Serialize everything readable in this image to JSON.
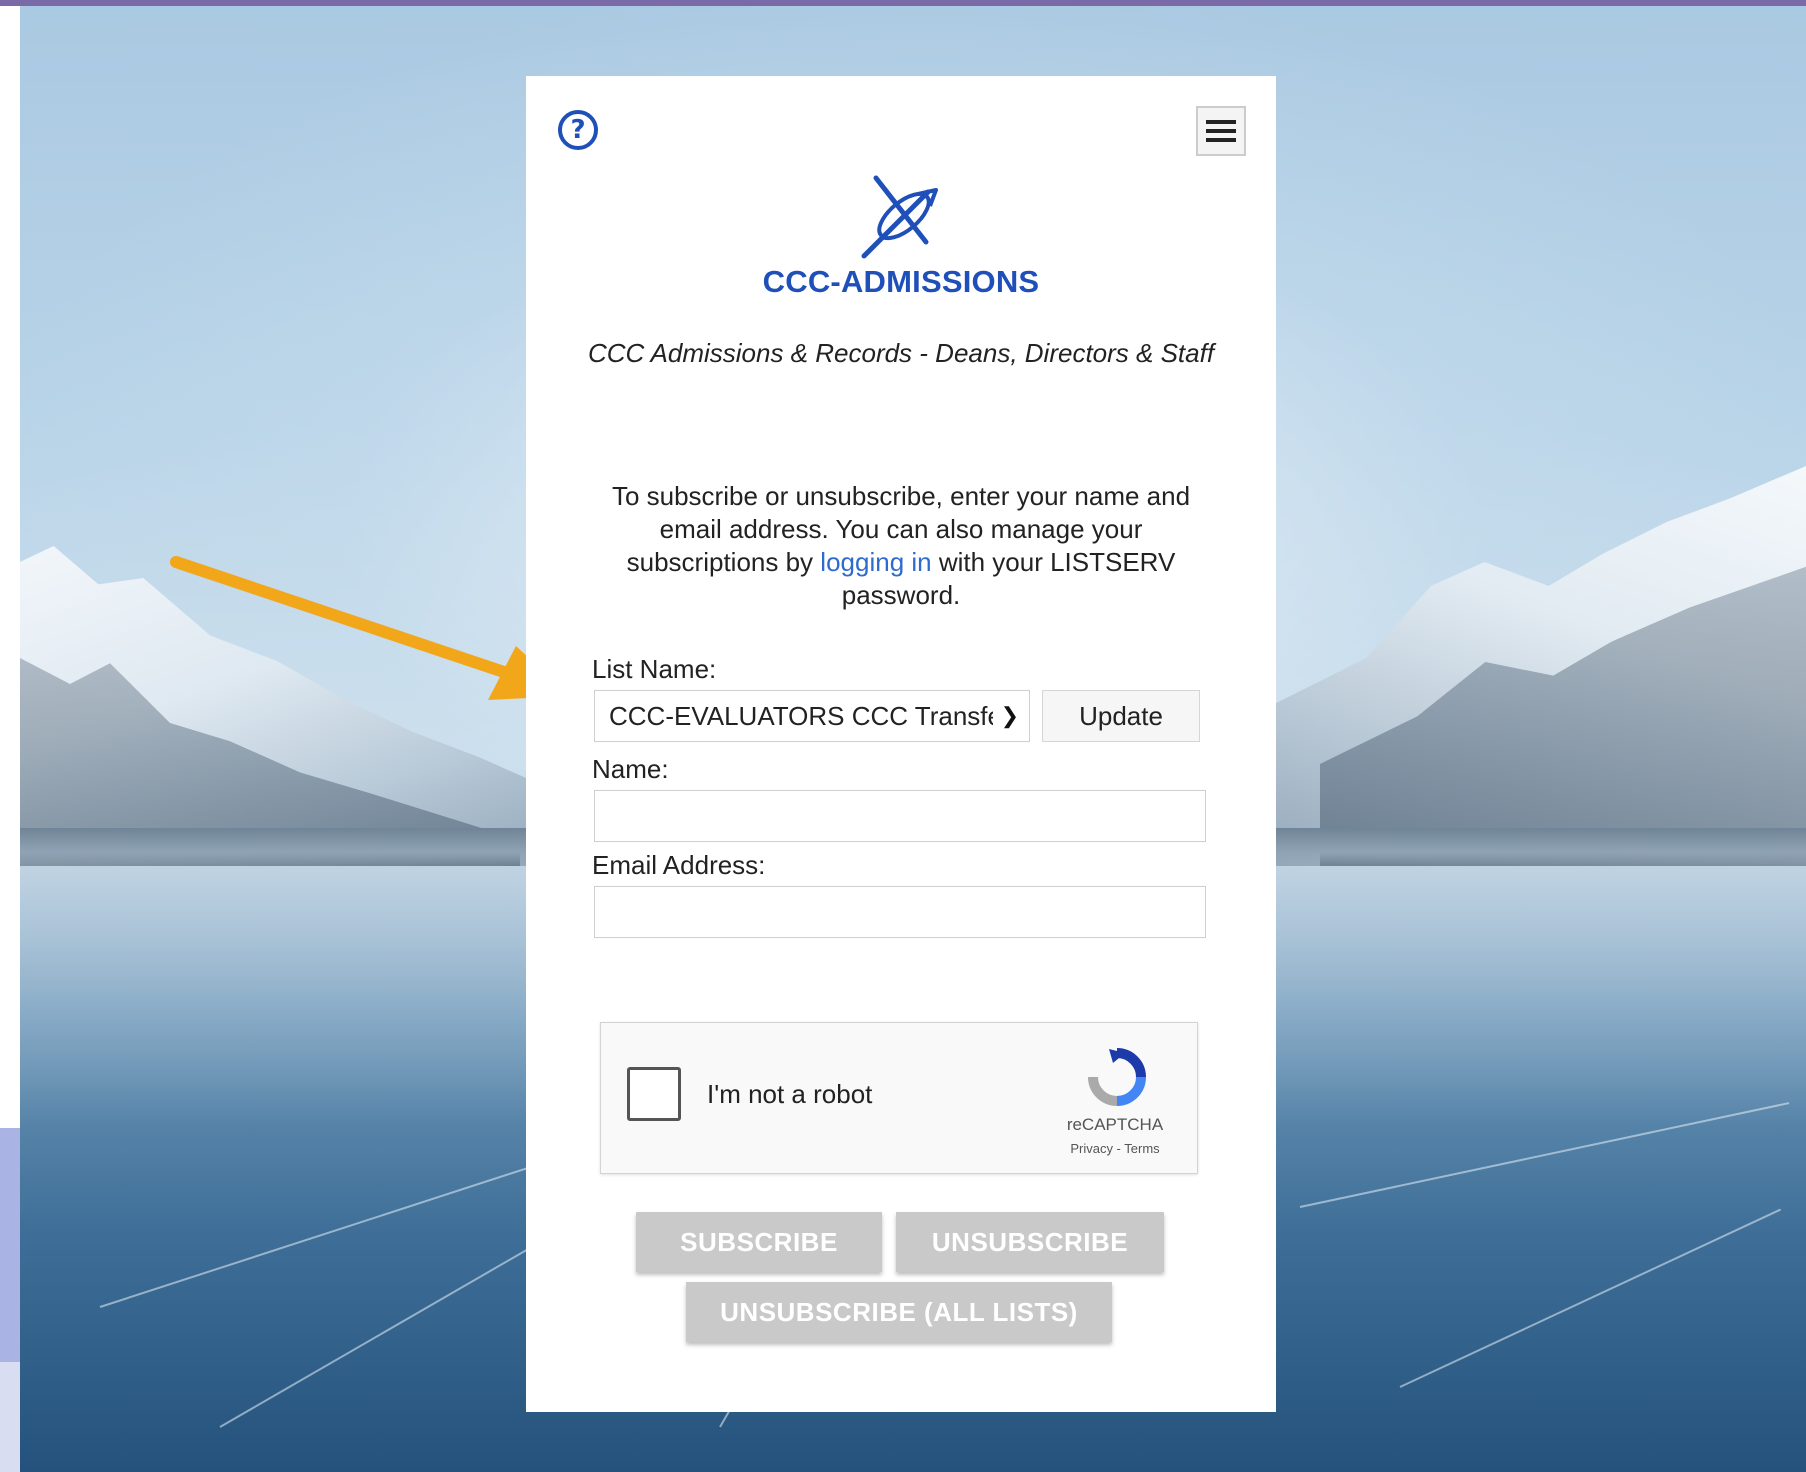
{
  "list": {
    "title": "CCC-ADMISSIONS",
    "description": "CCC Admissions & Records - Deans, Directors & Staff"
  },
  "intro": {
    "before_link": "To subscribe or unsubscribe, enter your name and email address. You can also manage your subscriptions by ",
    "link_text": "logging in",
    "after_link": " with your LISTSERV password."
  },
  "form": {
    "list_name_label": "List Name:",
    "list_name_selected": "CCC-EVALUATORS CCC Transfer Evaluators",
    "update_label": "Update",
    "name_label": "Name:",
    "name_value": "",
    "email_label": "Email Address:",
    "email_value": ""
  },
  "captcha": {
    "label": "I'm not a robot",
    "brand": "reCAPTCHA",
    "links": "Privacy - Terms"
  },
  "buttons": {
    "subscribe": "SUBSCRIBE",
    "unsubscribe": "UNSUBSCRIBE",
    "unsubscribe_all": "UNSUBSCRIBE (ALL LISTS)"
  },
  "icons": {
    "help": "question-circle-icon",
    "menu": "hamburger-menu-icon",
    "logo": "ccc-logo-icon",
    "captcha_logo": "recaptcha-logo-icon",
    "annotation": "orange-arrow-icon"
  },
  "colors": {
    "brand_blue": "#1f4fb8",
    "link_blue": "#2f6ad0",
    "disabled_button": "#c9c9c9",
    "arrow_orange": "#f2a71b"
  }
}
